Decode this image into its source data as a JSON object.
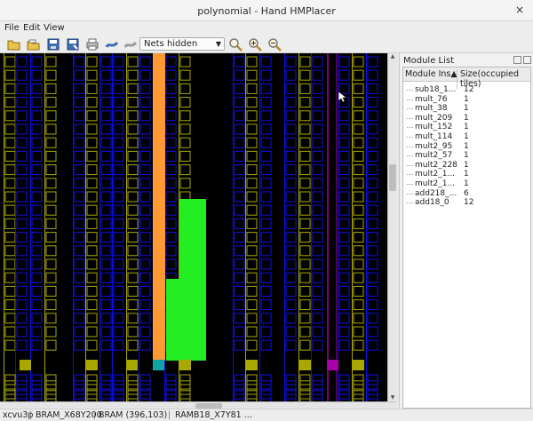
{
  "window": {
    "title": "polynomial - Hand HMPlacer",
    "close_label": "×"
  },
  "menu": {
    "file": "File",
    "edit": "Edit",
    "view": "View"
  },
  "toolbar": {
    "nets_select": "Nets hidden"
  },
  "module_list": {
    "title": "Module List",
    "col_module": "Module Ins▲",
    "col_size": "Size(occupied tiles)",
    "rows": [
      {
        "name": "sub18_1...",
        "size": "12"
      },
      {
        "name": "mult_76",
        "size": "1"
      },
      {
        "name": "mult_38",
        "size": "1"
      },
      {
        "name": "mult_209",
        "size": "1"
      },
      {
        "name": "mult_152",
        "size": "1"
      },
      {
        "name": "mult_114",
        "size": "1"
      },
      {
        "name": "mult2_95",
        "size": "1"
      },
      {
        "name": "mult2_57",
        "size": "1"
      },
      {
        "name": "mult2_228",
        "size": "1"
      },
      {
        "name": "mult2_1...",
        "size": "1"
      },
      {
        "name": "mult2_1...",
        "size": "1"
      },
      {
        "name": "add218_...",
        "size": "6"
      },
      {
        "name": "add18_0",
        "size": "12"
      }
    ]
  },
  "status": {
    "device": "xcvu3p",
    "tile": "BRAM_X68Y200",
    "coord": "BRAM (396,103)",
    "site": "RAMB18_X7Y81 ..."
  },
  "colors": {
    "background": "#000000",
    "clb_yellow": "#a8a800",
    "clb_blue": "#1010e0",
    "orange_module": "#ff9933",
    "green_module": "#22ee22",
    "purple_column": "#7a007a"
  }
}
